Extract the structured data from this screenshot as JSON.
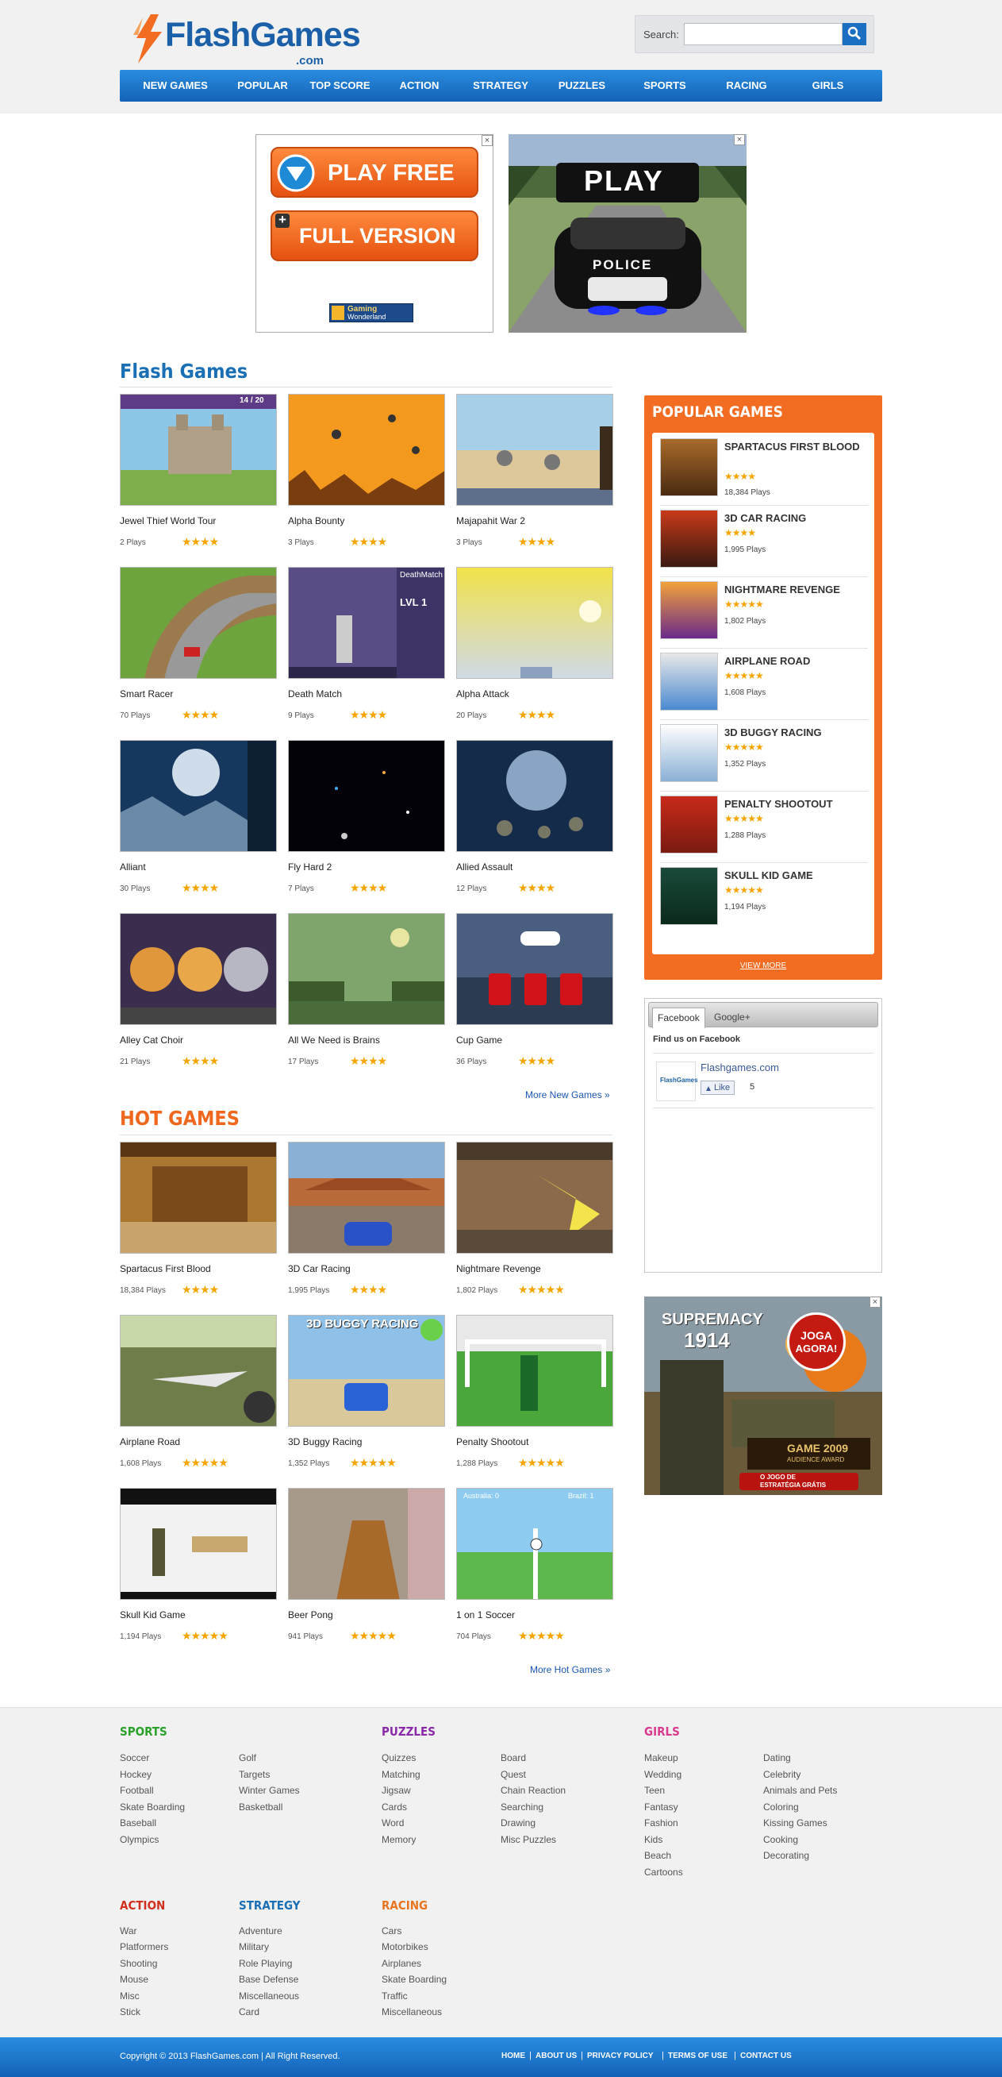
{
  "header": {
    "logo_main": "FlashGames",
    "logo_domain": ".com",
    "search_label": "Search:",
    "search_value": "",
    "search_placeholder": ""
  },
  "nav": [
    "NEW GAMES",
    "POPULAR",
    "TOP SCORE",
    "ACTION",
    "STRATEGY",
    "PUZZLES",
    "SPORTS",
    "RACING",
    "GIRLS"
  ],
  "ads": {
    "ad1": {
      "play_free": "PLAY FREE",
      "full_version": "FULL VERSION",
      "brand_line1": "Gaming",
      "brand_line2": "Wonderland",
      "close": "×"
    },
    "ad2": {
      "play": "PLAY",
      "police": "POLICE",
      "close": "×"
    },
    "ad3": {
      "line1": "SUPREMACY",
      "line2": "1914",
      "cta1": "JOGA",
      "cta2": "AGORA!",
      "award1": "GAME 2009",
      "award2": "AUDIENCE AWARD",
      "tag1": "O JOGO DE",
      "tag2": "ESTRATÉGIA GRÁTIS",
      "close": "×"
    }
  },
  "flash_games": {
    "title": "Flash Games",
    "games": [
      {
        "name": "Jewel Thief World Tour",
        "plays": "2 Plays",
        "stars": "★★★★",
        "hud": "14 / 20"
      },
      {
        "name": "Alpha Bounty",
        "plays": "3 Plays",
        "stars": "★★★★"
      },
      {
        "name": "Majapahit War 2",
        "plays": "3 Plays",
        "stars": "★★★★"
      },
      {
        "name": "Smart Racer",
        "plays": "70 Plays",
        "stars": "★★★★"
      },
      {
        "name": "Death Match",
        "plays": "9 Plays",
        "stars": "★★★★",
        "hud1": "DeathMatch",
        "hud2": "LVL 1"
      },
      {
        "name": "Alpha Attack",
        "plays": "20 Plays",
        "stars": "★★★★"
      },
      {
        "name": "Alliant",
        "plays": "30 Plays",
        "stars": "★★★★"
      },
      {
        "name": "Fly Hard 2",
        "plays": "7 Plays",
        "stars": "★★★★"
      },
      {
        "name": "Allied Assault",
        "plays": "12 Plays",
        "stars": "★★★★"
      },
      {
        "name": "Alley Cat Choir",
        "plays": "21 Plays",
        "stars": "★★★★"
      },
      {
        "name": "All We Need is Brains",
        "plays": "17 Plays",
        "stars": "★★★★"
      },
      {
        "name": "Cup Game",
        "plays": "36 Plays",
        "stars": "★★★★"
      }
    ],
    "more": "More New Games »"
  },
  "hot_games": {
    "title": "HOT GAMES",
    "games": [
      {
        "name": "Spartacus First Blood",
        "plays": "18,384 Plays",
        "stars": "★★★★"
      },
      {
        "name": "3D Car Racing",
        "plays": "1,995 Plays",
        "stars": "★★★★"
      },
      {
        "name": "Nightmare Revenge",
        "plays": "1,802 Plays",
        "stars": "★★★★★"
      },
      {
        "name": "Airplane Road",
        "plays": "1,608 Plays",
        "stars": "★★★★★"
      },
      {
        "name": "3D Buggy Racing",
        "plays": "1,352 Plays",
        "stars": "★★★★★",
        "hud": "3D BUGGY RACING"
      },
      {
        "name": "Penalty Shootout",
        "plays": "1,288 Plays",
        "stars": "★★★★★"
      },
      {
        "name": "Skull Kid Game",
        "plays": "1,194 Plays",
        "stars": "★★★★★"
      },
      {
        "name": "Beer Pong",
        "plays": "941 Plays",
        "stars": "★★★★★"
      },
      {
        "name": "1 on 1 Soccer",
        "plays": "704 Plays",
        "stars": "★★★★★",
        "hud1": "Australia: 0",
        "hud2": "Brazil: 1"
      }
    ],
    "more": "More Hot Games »"
  },
  "popular": {
    "title": "POPULAR GAMES",
    "items": [
      {
        "name": "SPARTACUS FIRST BLOOD",
        "stars": "★★★★",
        "plays": "18,384 Plays"
      },
      {
        "name": "3D CAR RACING",
        "stars": "★★★★",
        "plays": "1,995 Plays"
      },
      {
        "name": "NIGHTMARE REVENGE",
        "stars": "★★★★★",
        "plays": "1,802 Plays"
      },
      {
        "name": "AIRPLANE ROAD",
        "stars": "★★★★★",
        "plays": "1,608 Plays"
      },
      {
        "name": "3D BUGGY RACING",
        "stars": "★★★★★",
        "plays": "1,352 Plays"
      },
      {
        "name": "PENALTY SHOOTOUT",
        "stars": "★★★★★",
        "plays": "1,288 Plays"
      },
      {
        "name": "SKULL KID GAME",
        "stars": "★★★★★",
        "plays": "1,194 Plays"
      }
    ],
    "view_more": "VIEW MORE"
  },
  "social": {
    "tab_facebook": "Facebook",
    "tab_google": "Google+",
    "find_us": "Find us on Facebook",
    "page_name": "Flashgames.com",
    "like_label": "Like",
    "like_count": "5"
  },
  "footer": {
    "sports": {
      "title": "SPORTS",
      "col1": [
        "Soccer",
        "Hockey",
        "Football",
        "Skate Boarding",
        "Baseball",
        "Olympics"
      ],
      "col2": [
        "Golf",
        "Targets",
        "Winter Games",
        "Basketball"
      ]
    },
    "puzzles": {
      "title": "PUZZLES",
      "col1": [
        "Quizzes",
        "Matching",
        "Jigsaw",
        "Cards",
        "Word",
        "Memory"
      ],
      "col2": [
        "Board",
        "Quest",
        "Chain Reaction",
        "Searching",
        "Drawing",
        "Misc Puzzles"
      ]
    },
    "girls": {
      "title": "GIRLS",
      "col1": [
        "Makeup",
        "Wedding",
        "Teen",
        "Fantasy",
        "Fashion",
        "Kids",
        "Beach",
        "Cartoons"
      ],
      "col2": [
        "Dating",
        "Celebrity",
        "Animals and Pets",
        "Coloring",
        "Kissing Games",
        "Cooking",
        "Decorating"
      ]
    },
    "action": {
      "title": "ACTION",
      "col1": [
        "War",
        "Platformers",
        "Shooting",
        "Mouse",
        "Misc",
        "Stick"
      ]
    },
    "strategy": {
      "title": "STRATEGY",
      "col1": [
        "Adventure",
        "Military",
        "Role Playing",
        "Base Defense",
        "Miscellaneous",
        "Card"
      ]
    },
    "racing": {
      "title": "RACING",
      "col1": [
        "Cars",
        "Motorbikes",
        "Airplanes",
        "Skate Boarding",
        "Traffic",
        "Miscellaneous"
      ]
    }
  },
  "bottom": {
    "copyright": "Copyright © 2013 FlashGames.com | All Right Reserved.",
    "links": [
      "HOME",
      "ABOUT US",
      "PRIVACY POLICY",
      "TERMS OF USE",
      "CONTACT US"
    ],
    "separator": "|"
  },
  "colors": {
    "brand_blue": "#1a6fc2",
    "flash_title": "#1a6fb5",
    "hot_title": "#f0671e",
    "popular_orange": "#f26c22",
    "star": "#f5a400",
    "sports": "#2aa12a",
    "puzzles": "#8a2aa8",
    "girls": "#d93a8e",
    "action": "#d2301f",
    "strategy": "#1a6fb5",
    "racing": "#e8751f"
  }
}
